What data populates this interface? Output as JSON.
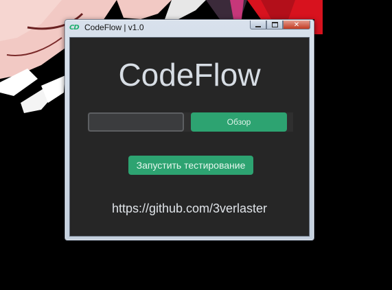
{
  "window": {
    "title": "CodeFlow | v1.0",
    "icon_text": "CD",
    "icon_color": "#1fae6e",
    "controls": {
      "minimize_icon": "minimize-icon",
      "maximize_icon": "maximize-icon",
      "close_icon": "close-icon",
      "close_glyph": "✕"
    }
  },
  "main": {
    "app_title": "CodeFlow",
    "path_input": {
      "value": "",
      "placeholder": ""
    },
    "browse_label": "Обзор",
    "run_tests_label": "Запустить тестирование",
    "repo_link": "https://github.com/3verlaster"
  },
  "colors": {
    "accent": "#2da371",
    "background": "#262626"
  }
}
